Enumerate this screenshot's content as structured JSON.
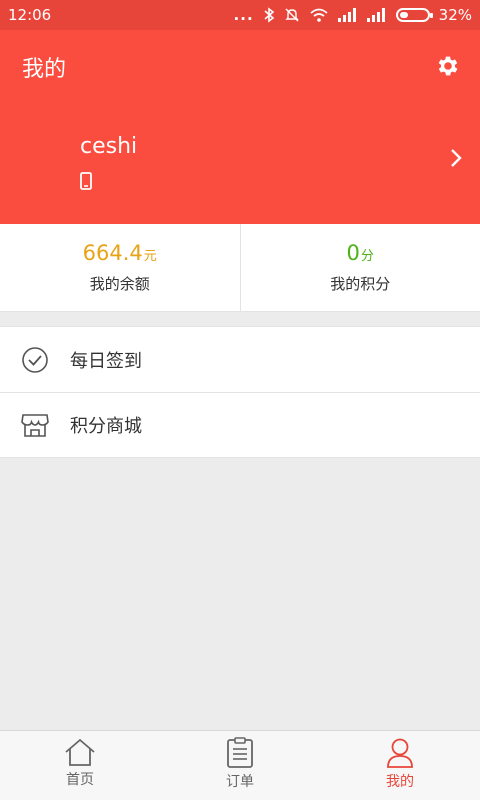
{
  "status_bar": {
    "time": "12:06",
    "dots": "...",
    "battery_text": "32%",
    "battery_level": 0.32,
    "icons": [
      "bluetooth-icon",
      "silent-bell-icon",
      "wifi-icon",
      "signal-icon",
      "signal-icon",
      "battery-icon"
    ]
  },
  "header": {
    "title": "我的",
    "settings_icon": "gear-icon",
    "username": "ceshi",
    "phone_icon": "phone-icon",
    "chevron_icon": "chevron-right-icon",
    "background_color": "#fa4c3f"
  },
  "stats": {
    "balance": {
      "value": "664.4",
      "unit": "元",
      "label": "我的余额",
      "color": "#e8a317"
    },
    "points": {
      "value": "0",
      "unit": "分",
      "label": "我的积分",
      "color": "#4db315"
    }
  },
  "menu": {
    "items": [
      {
        "label": "每日签到",
        "icon": "check-circle-icon"
      },
      {
        "label": "积分商城",
        "icon": "store-icon"
      }
    ]
  },
  "tab_bar": {
    "tabs": [
      {
        "label": "首页",
        "icon": "home-icon",
        "active": false
      },
      {
        "label": "订单",
        "icon": "order-list-icon",
        "active": false
      },
      {
        "label": "我的",
        "icon": "user-icon",
        "active": true
      }
    ],
    "active_color": "#e8453a"
  }
}
